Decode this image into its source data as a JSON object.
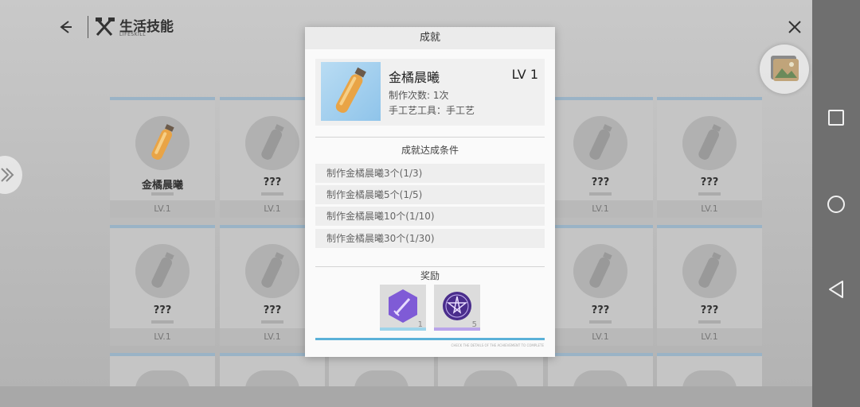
{
  "header": {
    "title": "生活技能",
    "subtitle": "LIFESKILL"
  },
  "grid": {
    "cards": [
      {
        "name": "金橘晨曦",
        "level": "LV.1",
        "unlocked": true
      },
      {
        "name": "???",
        "level": "LV.1",
        "unlocked": false
      },
      {
        "name": "???",
        "level": "LV.1",
        "unlocked": false
      },
      {
        "name": "???",
        "level": "LV.1",
        "unlocked": false
      },
      {
        "name": "???",
        "level": "LV.1",
        "unlocked": false
      },
      {
        "name": "???",
        "level": "LV.1",
        "unlocked": false
      },
      {
        "name": "???",
        "level": "LV.1",
        "unlocked": false
      },
      {
        "name": "???",
        "level": "LV.1",
        "unlocked": false
      }
    ]
  },
  "modal": {
    "title": "成就",
    "item": {
      "name": "金橘晨曦",
      "level": "LV 1",
      "craft_count": "制作次数: 1次",
      "tool": "手工艺工具：手工艺"
    },
    "conditions_title": "成就达成条件",
    "conditions": [
      "制作金橘晨曦3个(1/3)",
      "制作金橘晨曦5个(1/5)",
      "制作金橘晨曦10个(1/10)",
      "制作金橘晨曦30个(1/30)"
    ],
    "rewards_title": "奖励",
    "rewards": [
      {
        "icon": "sword-icon",
        "count": "1",
        "color": "#7f5bd6"
      },
      {
        "icon": "pentagram-medal-icon",
        "count": "5",
        "color": "#4a2d8c"
      }
    ],
    "progress": 1.0,
    "fine_print": "CHECK THE DETAILS OF THE ACHIEVEMENT TO COMPLETE"
  },
  "colors": {
    "accent": "#5ab1d8",
    "card_top": "#9ab3c6",
    "thumb_bg": "#8fc4ea"
  }
}
